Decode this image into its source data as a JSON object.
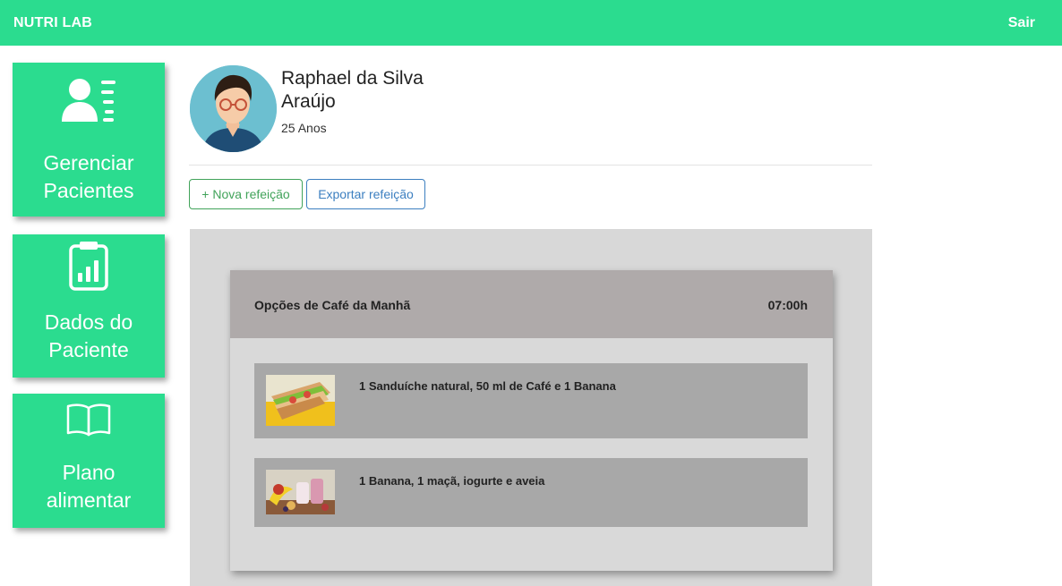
{
  "header": {
    "brand": "NUTRI LAB",
    "logout": "Sair"
  },
  "sidebar": {
    "items": [
      {
        "line1": "Gerenciar",
        "line2": "Pacientes",
        "icon": "patient-list-icon"
      },
      {
        "line1": "Dados do",
        "line2": "Paciente",
        "icon": "clipboard-chart-icon"
      },
      {
        "line1": "Plano",
        "line2": "alimentar",
        "icon": "open-book-icon"
      }
    ]
  },
  "patient": {
    "name_line1": "Raphael da Silva",
    "name_line2": "Araújo",
    "age": "25 Anos"
  },
  "actions": {
    "new_meal": "+ Nova refeição",
    "export_meal": "Exportar refeição"
  },
  "meal": {
    "title": "Opções de Café da Manhã",
    "time": "07:00h",
    "options": [
      {
        "text": "1 Sanduíche natural, 50 ml de Café e 1 Banana",
        "image": "sandwich-photo"
      },
      {
        "text": "1 Banana, 1 maçã, iogurte e aveia",
        "image": "fruit-yogurt-photo"
      }
    ]
  },
  "colors": {
    "accent": "#2bdc8f",
    "panel": "#d8d8d8",
    "card_header": "#afaaaa",
    "item": "#a8a8a8"
  }
}
